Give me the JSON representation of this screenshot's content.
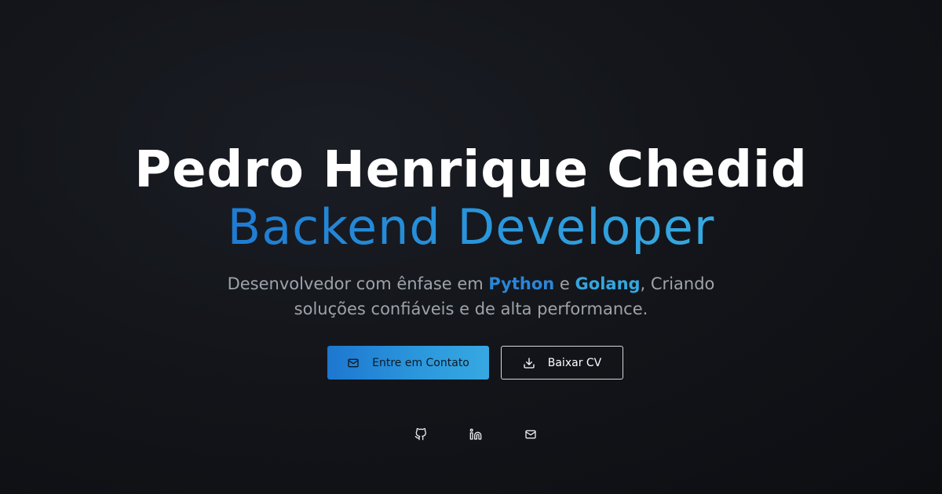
{
  "hero": {
    "name": "Pedro Henrique Chedid",
    "role": "Backend Developer",
    "description": {
      "before": "Desenvolvedor com ênfase em ",
      "python": "Python",
      "middle": " e ",
      "golang": "Golang",
      "after_line1": ", Criando",
      "line2": "soluções confiáveis e de alta performance."
    }
  },
  "buttons": {
    "contact_label": "Entre em Contato",
    "contact_icon": "mail-icon",
    "cv_label": "Baixar CV",
    "cv_icon": "download-icon"
  },
  "social": [
    {
      "icon": "github-icon"
    },
    {
      "icon": "linkedin-icon"
    },
    {
      "icon": "mail-icon"
    }
  ],
  "colors": {
    "background": "#13151a",
    "accent_start": "#1d77d0",
    "accent_end": "#36a8e1",
    "python": "#2a86d8",
    "golang": "#35a6df",
    "muted_text": "#9ea3ab"
  }
}
